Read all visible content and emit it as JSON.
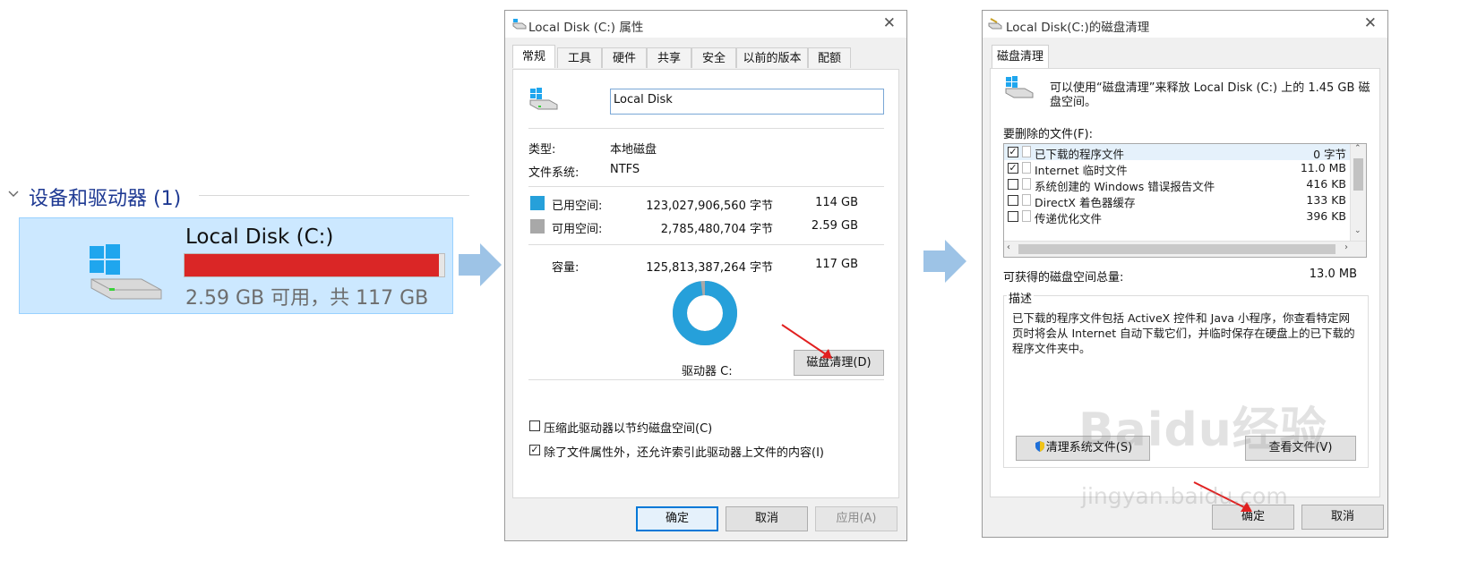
{
  "left": {
    "group_title": "设备和驱动器 (1)",
    "drive_name": "Local Disk (C:)",
    "drive_free_text": "2.59 GB 可用，共 117 GB",
    "used_fraction": 0.978,
    "bar_color": "#da2626"
  },
  "props": {
    "title": "Local Disk (C:) 属性",
    "tabs": [
      "常规",
      "工具",
      "硬件",
      "共享",
      "安全",
      "以前的版本",
      "配额"
    ],
    "name_value": "Local Disk",
    "type_label": "类型:",
    "type_value": "本地磁盘",
    "fs_label": "文件系统:",
    "fs_value": "NTFS",
    "used_label": "已用空间:",
    "used_bytes": "123,027,906,560 字节",
    "used_gb": "114 GB",
    "free_label": "可用空间:",
    "free_bytes": "2,785,480,704 字节",
    "free_gb": "2.59 GB",
    "capacity_label": "容量:",
    "capacity_bytes": "125,813,387,264 字节",
    "capacity_gb": "117 GB",
    "drive_label": "驱动器 C:",
    "cleanup_button": "磁盘清理(D)",
    "compress_label": "压缩此驱动器以节约磁盘空间(C)",
    "index_label": "除了文件属性外，还允许索引此驱动器上文件的内容(I)",
    "ok": "确定",
    "cancel": "取消",
    "apply": "应用(A)",
    "used_color": "#26a0da",
    "free_color": "#a8a8a8"
  },
  "cleanup": {
    "title": "Local Disk(C:)的磁盘清理",
    "tab": "磁盘清理",
    "intro": "可以使用“磁盘清理”来释放 Local Disk (C:) 上的 1.45 GB 磁盘空间。",
    "files_label": "要删除的文件(F):",
    "files": [
      {
        "name": "已下载的程序文件",
        "size": "0 字节",
        "checked": true
      },
      {
        "name": "Internet 临时文件",
        "size": "11.0 MB",
        "checked": true
      },
      {
        "name": "系统创建的 Windows 错误报告文件",
        "size": "416 KB",
        "checked": false
      },
      {
        "name": "DirectX 着色器缓存",
        "size": "133 KB",
        "checked": false
      },
      {
        "name": "传递优化文件",
        "size": "396 KB",
        "checked": false
      }
    ],
    "total_label": "可获得的磁盘空间总量:",
    "total_value": "13.0 MB",
    "desc_label": "描述",
    "desc_text": "已下载的程序文件包括 ActiveX 控件和 Java 小程序，你查看特定网页时将会从 Internet 自动下载它们，并临时保存在硬盘上的已下载的程序文件夹中。",
    "clean_sys_button": "清理系统文件(S)",
    "view_files_button": "查看文件(V)",
    "ok": "确定",
    "cancel": "取消"
  },
  "watermark": {
    "logo": "Baidu经验",
    "url": "jingyan.baidu.com"
  }
}
